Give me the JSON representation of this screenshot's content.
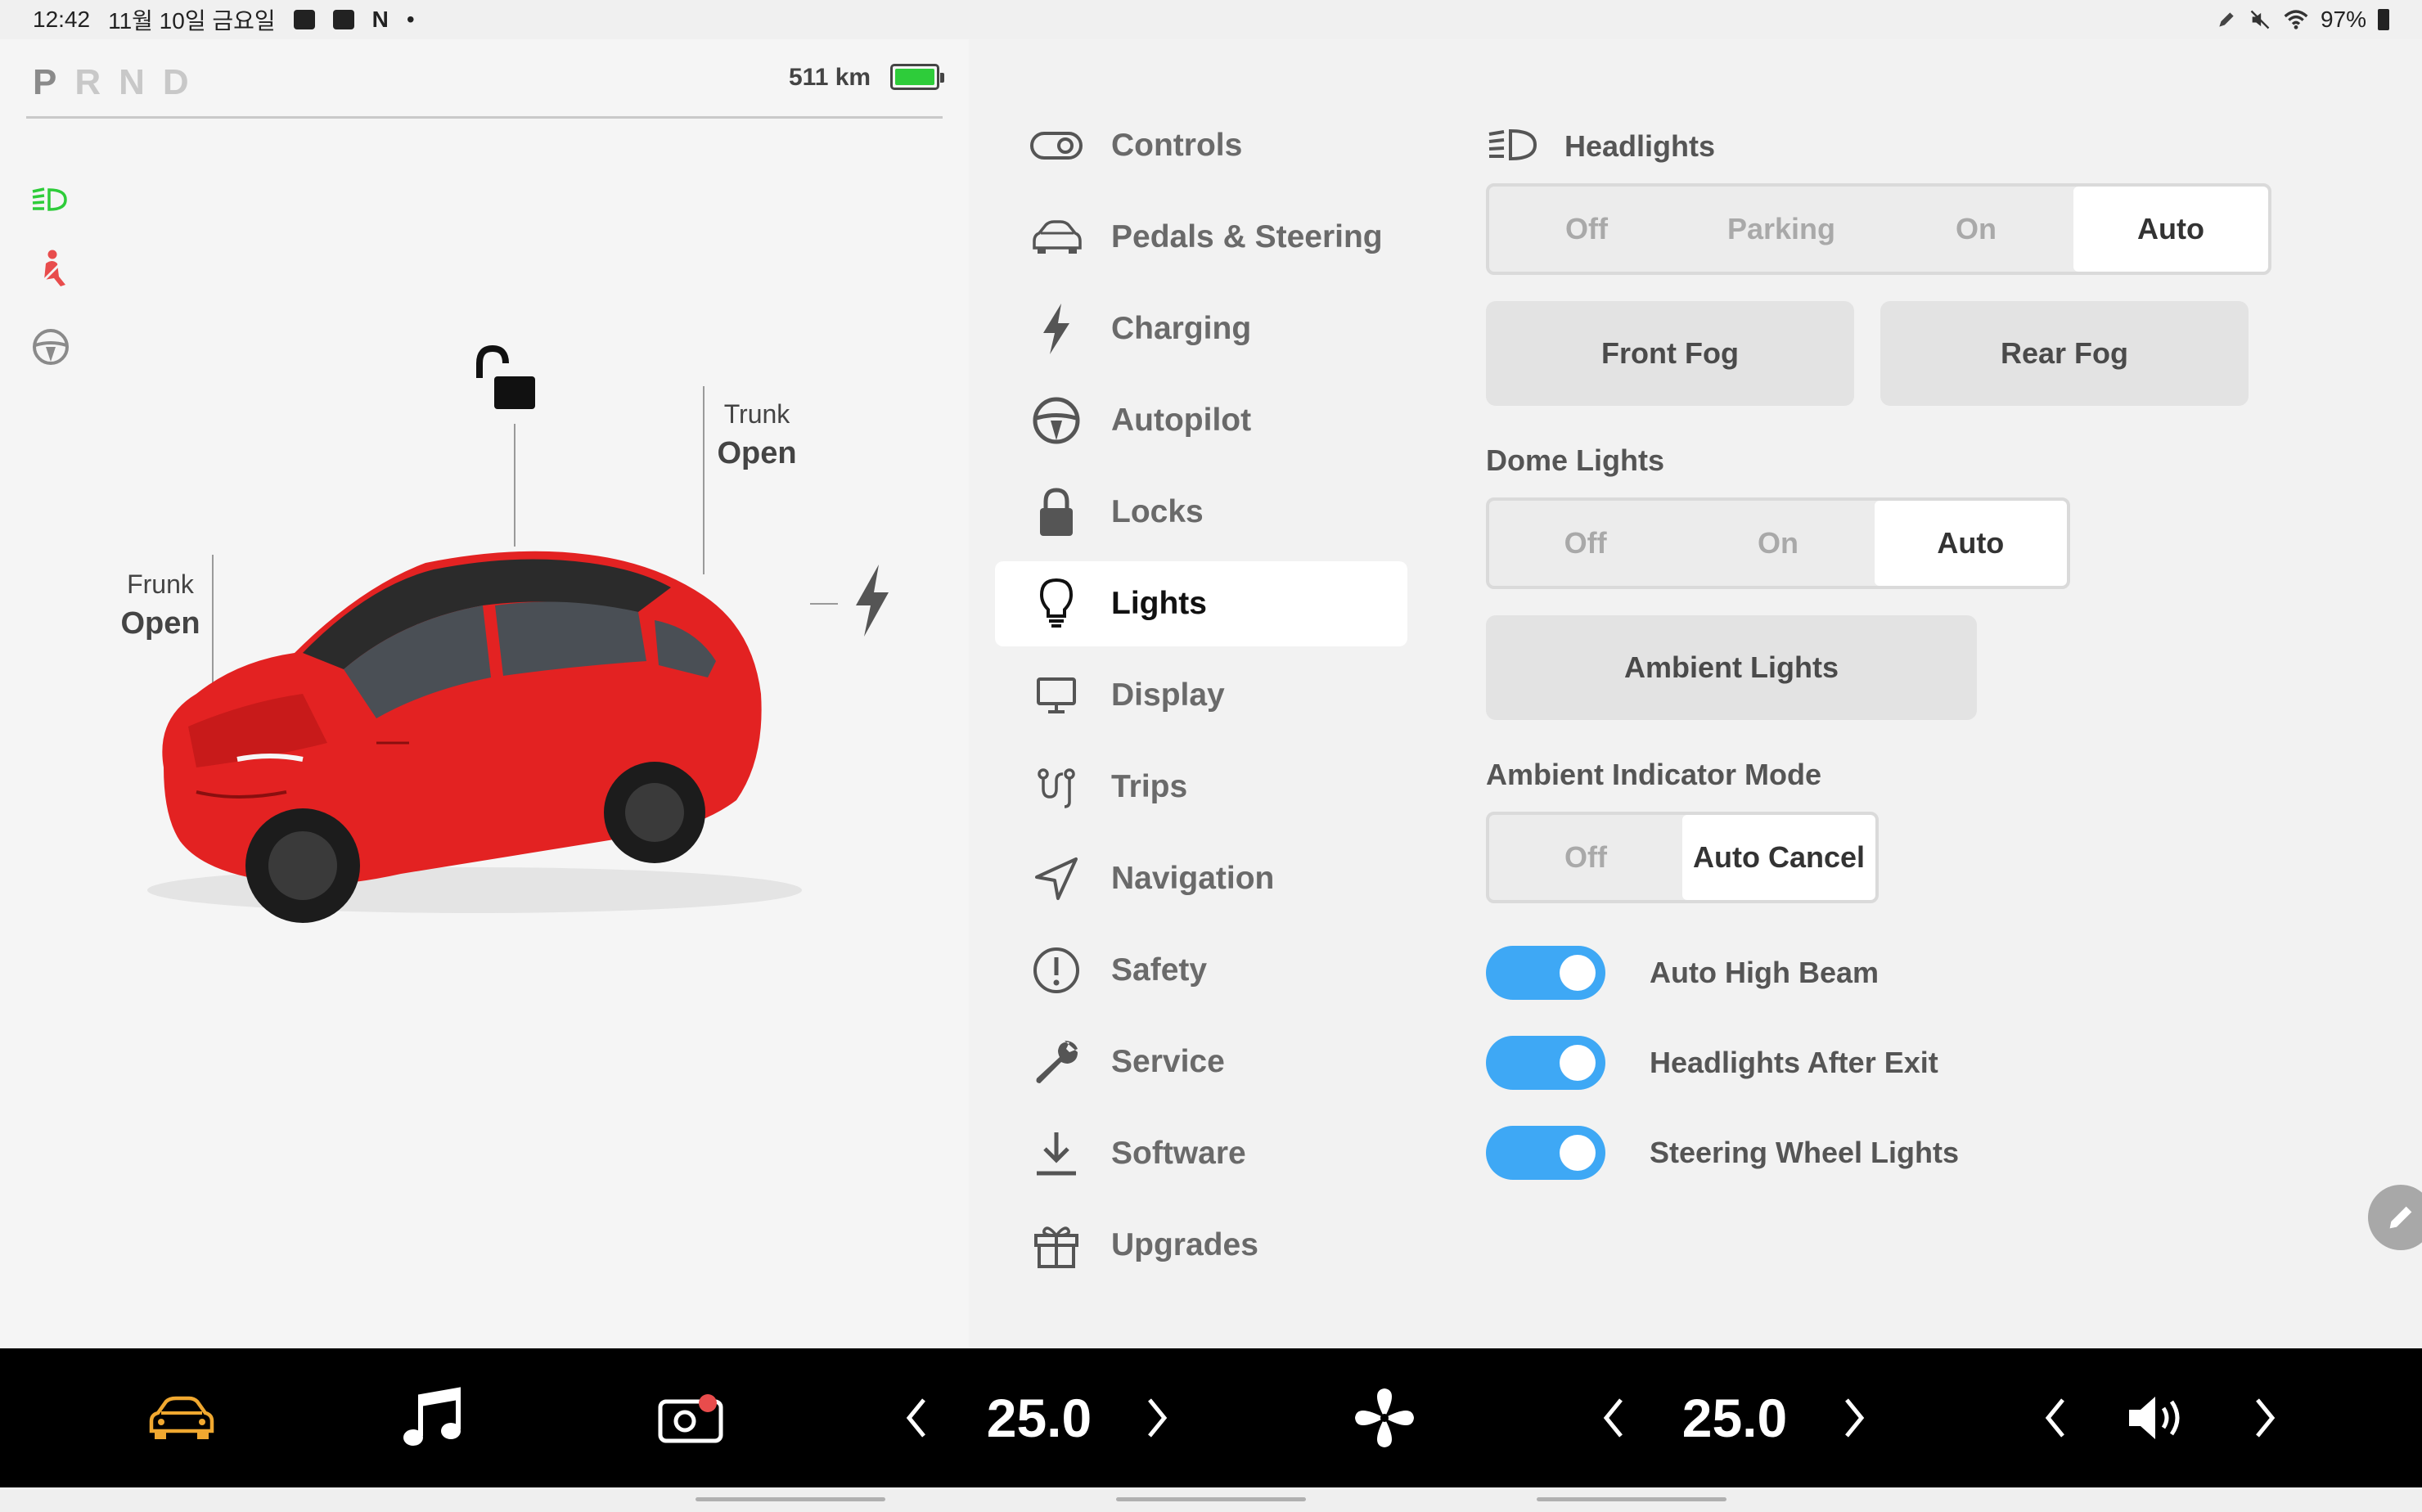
{
  "status_bar": {
    "time": "12:42",
    "date": "11월 10일 금요일",
    "app_letter": "N",
    "dot": "•",
    "battery_pct": "97%"
  },
  "vehicle": {
    "gears": [
      "P",
      "R",
      "N",
      "D"
    ],
    "active_gear": "P",
    "range": "511 km",
    "battery_level": 1.0,
    "frunk": {
      "title": "Frunk",
      "state": "Open"
    },
    "trunk": {
      "title": "Trunk",
      "state": "Open"
    },
    "telltales": [
      "headlight-icon",
      "seatbelt-warning-icon",
      "steering-wheel-icon"
    ],
    "colors": {
      "headlight_telltale": "#2ecc3a",
      "seatbelt_warning": "#e84c4c",
      "battery_fill": "#2ecc3a",
      "car_body": "#e32222"
    }
  },
  "menu": {
    "items": [
      {
        "label": "Controls",
        "icon": "toggle-icon"
      },
      {
        "label": "Pedals & Steering",
        "icon": "car-icon"
      },
      {
        "label": "Charging",
        "icon": "bolt-icon"
      },
      {
        "label": "Autopilot",
        "icon": "steering-wheel-icon"
      },
      {
        "label": "Locks",
        "icon": "lock-icon"
      },
      {
        "label": "Lights",
        "icon": "bulb-icon"
      },
      {
        "label": "Display",
        "icon": "monitor-icon"
      },
      {
        "label": "Trips",
        "icon": "trips-icon"
      },
      {
        "label": "Navigation",
        "icon": "navigation-icon"
      },
      {
        "label": "Safety",
        "icon": "alert-icon"
      },
      {
        "label": "Service",
        "icon": "wrench-icon"
      },
      {
        "label": "Software",
        "icon": "download-icon"
      },
      {
        "label": "Upgrades",
        "icon": "gift-icon"
      }
    ],
    "selected": "Lights"
  },
  "lights": {
    "headlights": {
      "label": "Headlights",
      "options": [
        "Off",
        "Parking",
        "On",
        "Auto"
      ],
      "selected": "Auto"
    },
    "fog": {
      "front": "Front Fog",
      "rear": "Rear Fog"
    },
    "dome": {
      "label": "Dome Lights",
      "options": [
        "Off",
        "On",
        "Auto"
      ],
      "selected": "Auto"
    },
    "ambient_button": "Ambient Lights",
    "ambient_mode": {
      "label": "Ambient Indicator Mode",
      "options": [
        "Off",
        "Auto Cancel"
      ],
      "selected": "Auto Cancel"
    },
    "toggles": [
      {
        "label": "Auto High Beam",
        "on": true
      },
      {
        "label": "Headlights After Exit",
        "on": true
      },
      {
        "label": "Steering Wheel Lights",
        "on": true
      }
    ],
    "toggle_color": "#3ea8f5"
  },
  "bottom_bar": {
    "driver_temp": "25.0",
    "passenger_temp": "25.0",
    "icons": [
      "car-icon",
      "music-icon",
      "dashcam-icon",
      "fan-icon",
      "volume-icon"
    ],
    "car_icon_color": "#f0a830",
    "dashcam_dot_color": "#e84c4c"
  }
}
